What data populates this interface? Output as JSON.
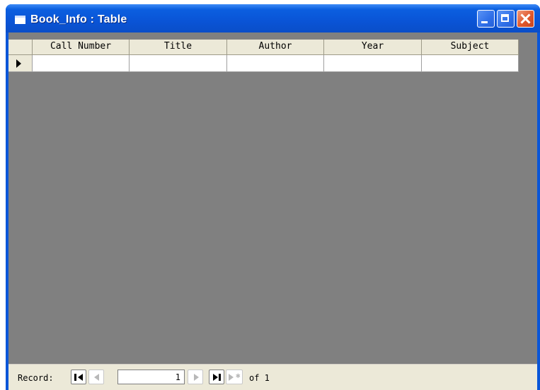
{
  "window": {
    "title": "Book_Info : Table"
  },
  "table": {
    "columns": [
      "Call Number",
      "Title",
      "Author",
      "Year",
      "Subject"
    ],
    "rows": [
      [
        "",
        "",
        "",
        "",
        ""
      ]
    ]
  },
  "navigation": {
    "record_label": "Record:",
    "current_record": "1",
    "total_label": "of 1"
  },
  "colors": {
    "titlebar": "#0a54d6",
    "workspace": "#808080",
    "chrome": "#ece9d8",
    "close_button": "#e0582d"
  },
  "icons": [
    "table-icon",
    "minimize-icon",
    "maximize-icon",
    "close-icon",
    "first-record-icon",
    "previous-record-icon",
    "next-record-icon",
    "last-record-icon",
    "new-record-icon",
    "row-selector-arrow-icon"
  ]
}
